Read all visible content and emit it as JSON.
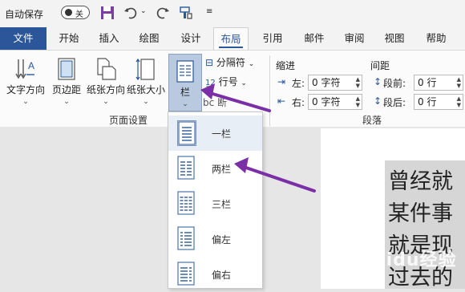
{
  "qat": {
    "autosave_label": "自动保存",
    "autosave_state": "关",
    "icons": [
      "save-icon",
      "undo-icon",
      "undo-dropdown-icon",
      "redo-icon",
      "format-painter-icon",
      "customize-qat-icon"
    ]
  },
  "tabs": [
    "文件",
    "开始",
    "插入",
    "绘图",
    "设计",
    "布局",
    "引用",
    "邮件",
    "审阅",
    "视图",
    "帮助"
  ],
  "active_tab": "布局",
  "ribbon": {
    "page_setup": {
      "text_direction": "文字方向",
      "margins": "页边距",
      "orientation": "纸张方向",
      "size": "纸张大小",
      "columns": "栏",
      "breaks": "分隔符",
      "line_numbers": "行号",
      "hyphenation_fragment": "断",
      "group_label": "页面设置"
    },
    "paragraph": {
      "indent_label": "缩进",
      "spacing_label": "间距",
      "left_label": "左:",
      "right_label": "右:",
      "before_label": "段前:",
      "after_label": "段后:",
      "left_value": "0 字符",
      "right_value": "0 字符",
      "before_value": "0 行",
      "after_value": "0 行",
      "group_label": "段落"
    }
  },
  "columns_menu": {
    "items": [
      {
        "label": "一栏",
        "icon": "one-column-icon"
      },
      {
        "label": "两栏",
        "icon": "two-columns-icon"
      },
      {
        "label": "三栏",
        "icon": "three-columns-icon"
      },
      {
        "label": "偏左",
        "icon": "left-column-icon"
      },
      {
        "label": "偏右",
        "icon": "right-column-icon"
      }
    ],
    "selected_index": 0
  },
  "document": {
    "lines": [
      "曾经就",
      "某件事",
      "就是现",
      "过去的"
    ]
  },
  "watermark": "Baidu经验",
  "colors": {
    "accent": "#2b579a",
    "arrow": "#7b2fa7",
    "selected_button": "#b9c9df"
  }
}
